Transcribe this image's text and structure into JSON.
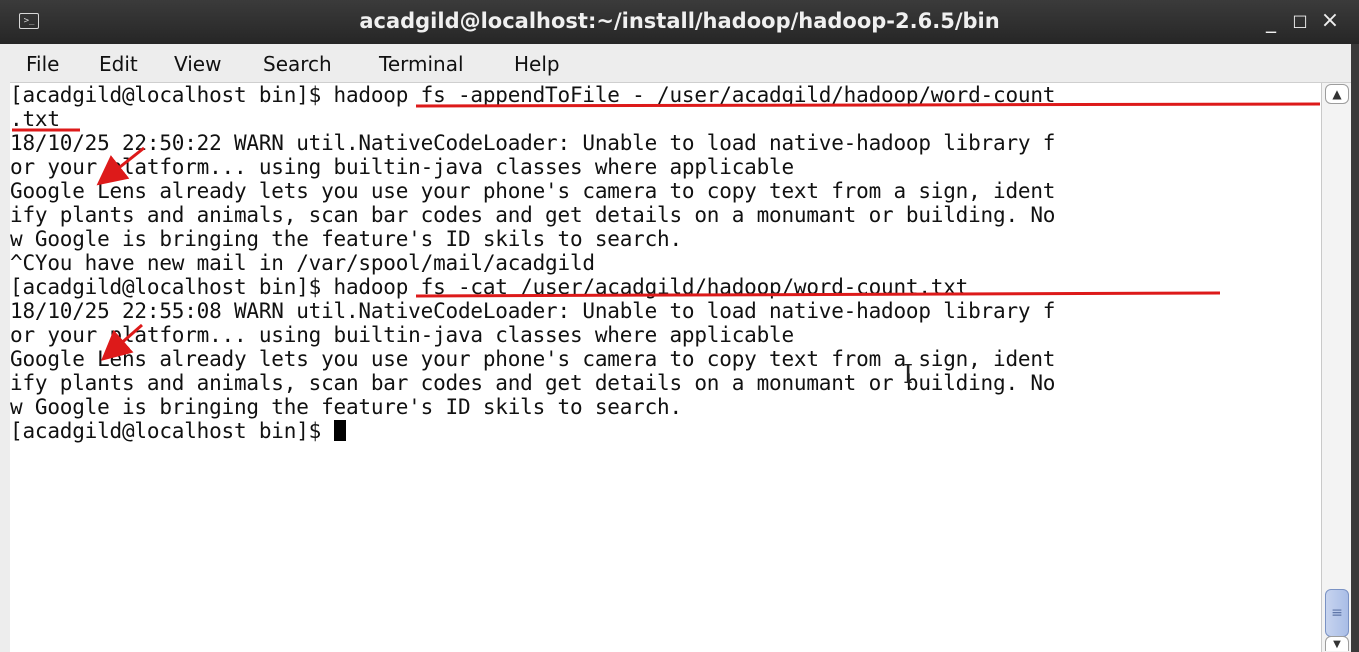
{
  "window": {
    "title": "acadgild@localhost:~/install/hadoop/hadoop-2.6.5/bin",
    "icon": "terminal-icon",
    "controls": {
      "minimize": "_",
      "maximize": "□",
      "close": "×"
    }
  },
  "menubar": {
    "items": [
      "File",
      "Edit",
      "View",
      "Search",
      "Terminal",
      "Help"
    ]
  },
  "terminal": {
    "lines": [
      "[acadgild@localhost bin]$ hadoop fs -appendToFile - /user/acadgild/hadoop/word-count",
      ".txt",
      "18/10/25 22:50:22 WARN util.NativeCodeLoader: Unable to load native-hadoop library f",
      "or your platform... using builtin-java classes where applicable",
      "Google Lens already lets you use your phone's camera to copy text from a sign, ident",
      "ify plants and animals, scan bar codes and get details on a monumant or building. No",
      "w Google is bringing the feature's ID skils to search.",
      "^CYou have new mail in /var/spool/mail/acadgild",
      "[acadgild@localhost bin]$ hadoop fs -cat /user/acadgild/hadoop/word-count.txt",
      "18/10/25 22:55:08 WARN util.NativeCodeLoader: Unable to load native-hadoop library f",
      "or your platform... using builtin-java classes where applicable",
      "Google Lens already lets you use your phone's camera to copy text from a sign, ident",
      "ify plants and animals, scan bar codes and get details on a monumant or building. No",
      "w Google is bringing the feature's ID skils to search.",
      "[acadgild@localhost bin]$ "
    ]
  },
  "scrollbar": {
    "up_icon": "chevron-up-icon",
    "down_icon": "chevron-down-icon",
    "position_fraction": 0.92
  },
  "annotations": {
    "underline_color": "#dd1a1a",
    "arrow_color": "#dd1a1a"
  }
}
